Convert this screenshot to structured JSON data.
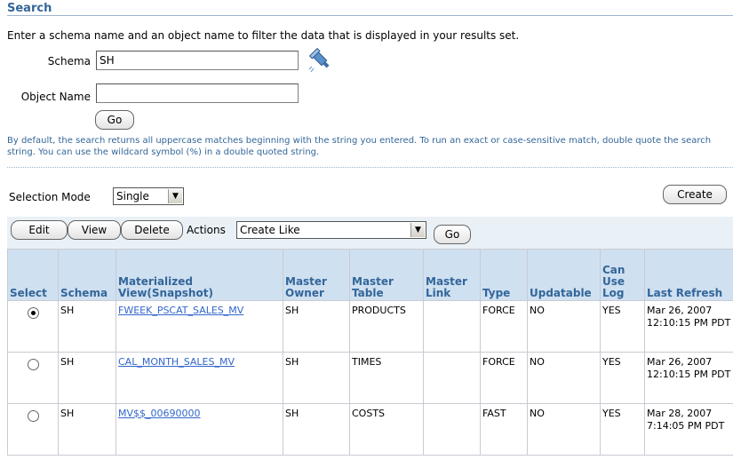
{
  "search": {
    "title": "Search",
    "instructions": "Enter a schema name and an object name to filter the data that is displayed in your results set.",
    "schema_label": "Schema",
    "schema_value": "SH",
    "object_label": "Object Name",
    "object_value": "",
    "go_label": "Go",
    "hint": "By default, the search returns all uppercase matches beginning with the string you entered. To run an exact or case-sensitive match, double quote the search string. You can use the wildcard symbol (%) in a double quoted string."
  },
  "selection": {
    "mode_label": "Selection Mode",
    "mode_value": "Single",
    "create_label": "Create"
  },
  "actions": {
    "edit_label": "Edit",
    "view_label": "View",
    "delete_label": "Delete",
    "actions_label": "Actions",
    "actions_value": "Create Like",
    "go_label": "Go"
  },
  "table": {
    "headers": {
      "select": "Select",
      "schema": "Schema",
      "mview": "Materialized View(Snapshot)",
      "owner": "Master Owner",
      "mtable": "Master Table",
      "mlink": "Master Link",
      "type": "Type",
      "updatable": "Updatable",
      "canuselog": "Can Use Log",
      "refresh": "Last Refresh"
    },
    "rows": [
      {
        "selected": true,
        "schema": "SH",
        "mview": "FWEEK_PSCAT_SALES_MV",
        "owner": "SH",
        "mtable": "PRODUCTS",
        "mlink": "",
        "type": "FORCE",
        "updatable": "NO",
        "canuselog": "YES",
        "refresh": "Mar 26, 2007 12:10:15 PM PDT"
      },
      {
        "selected": false,
        "schema": "SH",
        "mview": "CAL_MONTH_SALES_MV",
        "owner": "SH",
        "mtable": "TIMES",
        "mlink": "",
        "type": "FORCE",
        "updatable": "NO",
        "canuselog": "YES",
        "refresh": "Mar 26, 2007 12:10:15 PM PDT"
      },
      {
        "selected": false,
        "schema": "SH",
        "mview": "MV$$_00690000",
        "owner": "SH",
        "mtable": "COSTS",
        "mlink": "",
        "type": "FAST",
        "updatable": "NO",
        "canuselog": "YES",
        "refresh": "Mar 28, 2007 7:14:05 PM PDT"
      }
    ]
  },
  "colors": {
    "accent": "#336699",
    "header_bg": "#cfe0f1",
    "link": "#3366cc"
  },
  "icons": {
    "flashlight": "flashlight-icon",
    "dropdown": "chevron-down-icon"
  }
}
